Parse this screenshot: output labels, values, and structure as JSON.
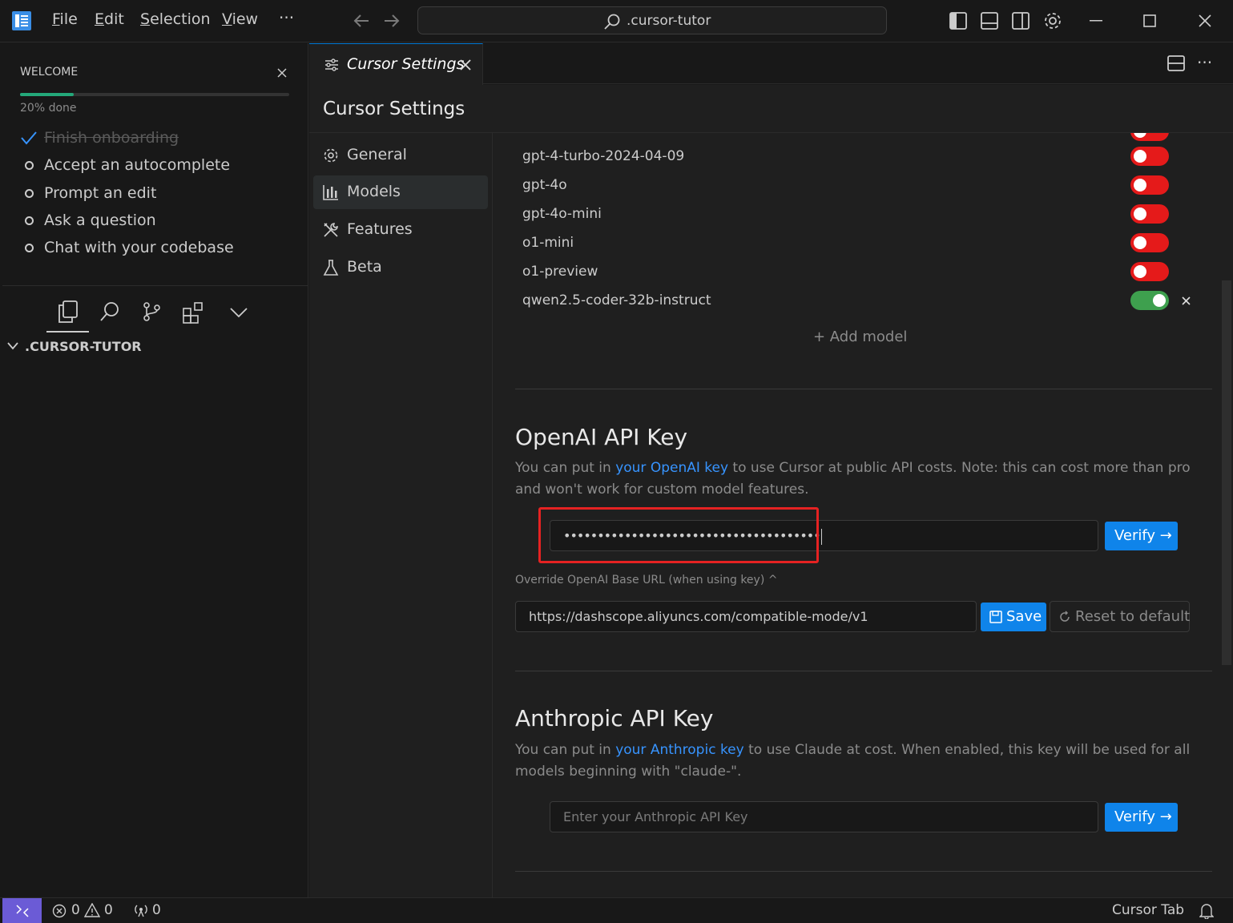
{
  "menu": {
    "file": "File",
    "edit": "Edit",
    "selection": "Selection",
    "view": "View",
    "more": "···"
  },
  "search": {
    "text": ".cursor-tutor"
  },
  "welcome": {
    "title": "WELCOME",
    "progress_text": "20% done",
    "progress_fraction": 0.2,
    "items": [
      {
        "label": "Finish onboarding",
        "done": true
      },
      {
        "label": "Accept an autocomplete",
        "done": false
      },
      {
        "label": "Prompt an edit",
        "done": false
      },
      {
        "label": "Ask a question",
        "done": false
      },
      {
        "label": "Chat with your codebase",
        "done": false
      }
    ]
  },
  "explorer": {
    "folder": ".CURSOR-TUTOR"
  },
  "tab": {
    "label": "Cursor Settings"
  },
  "settings": {
    "title": "Cursor Settings",
    "nav": [
      {
        "label": "General",
        "icon": "gear-icon"
      },
      {
        "label": "Models",
        "icon": "chart-icon"
      },
      {
        "label": "Features",
        "icon": "tools-icon"
      },
      {
        "label": "Beta",
        "icon": "flask-icon"
      }
    ],
    "models": [
      {
        "name": "gpt-4-turbo-2024-04-09",
        "enabled": false
      },
      {
        "name": "gpt-4o",
        "enabled": false
      },
      {
        "name": "gpt-4o-mini",
        "enabled": false
      },
      {
        "name": "o1-mini",
        "enabled": false
      },
      {
        "name": "o1-preview",
        "enabled": false
      },
      {
        "name": "qwen2.5-coder-32b-instruct",
        "enabled": true
      }
    ],
    "add_model": "+ Add model",
    "openai": {
      "title": "OpenAI API Key",
      "desc_prefix": "You can put in ",
      "desc_link": "your OpenAI key",
      "desc_suffix": " to use Cursor at public API costs. Note: this can cost more than pro and won't work for custom model features.",
      "key_value": "••••••••••••••••••••••••••••••••••••••",
      "verify": "Verify →",
      "override_label": "Override OpenAI Base URL (when using key) ^",
      "base_url": "https://dashscope.aliyuncs.com/compatible-mode/v1",
      "save": "Save",
      "reset": "Reset to default"
    },
    "anthropic": {
      "title": "Anthropic API Key",
      "desc_prefix": "You can put in ",
      "desc_link": "your Anthropic key",
      "desc_suffix": " to use Claude at cost. When enabled, this key will be used for all models beginning with \"claude-\".",
      "placeholder": "Enter your Anthropic API Key",
      "verify": "Verify →"
    }
  },
  "status": {
    "errors": "0",
    "warnings": "0",
    "ports": "0",
    "cursor_tab": "Cursor Tab"
  },
  "colors": {
    "accent": "#0f84ea",
    "toggle_off": "#e51a1a",
    "toggle_on": "#3ea04e",
    "highlight": "#e52222"
  }
}
